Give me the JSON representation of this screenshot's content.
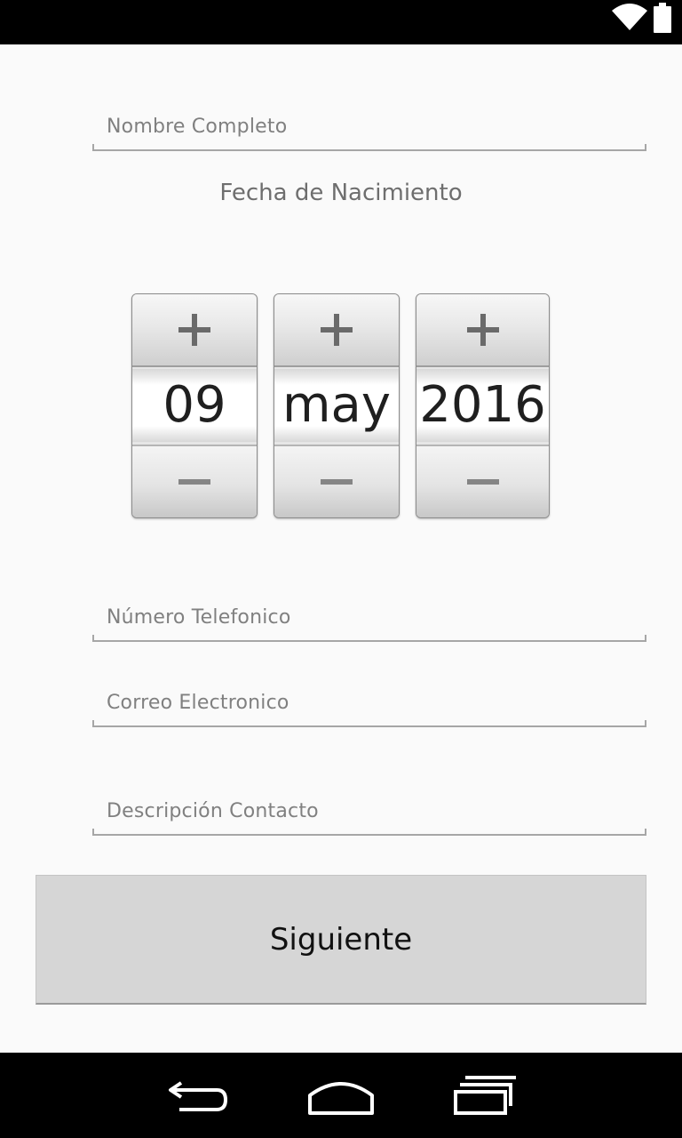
{
  "status_bar": {
    "icons": [
      "wifi-icon",
      "battery-icon"
    ]
  },
  "form": {
    "full_name_placeholder": "Nombre Completo",
    "birth_date_label": "Fecha de Nacimiento",
    "phone_placeholder": "Número Telefonico",
    "email_placeholder": "Correo Electronico",
    "contact_description_placeholder": "Descripción Contacto",
    "next_button_label": "Siguiente"
  },
  "date_picker": {
    "day": "09",
    "month": "may",
    "year": "2016",
    "increment_icon": "plus-icon",
    "decrement_icon": "minus-icon"
  },
  "nav_bar": {
    "icons": [
      "back-icon",
      "home-icon",
      "recent-apps-icon"
    ]
  }
}
